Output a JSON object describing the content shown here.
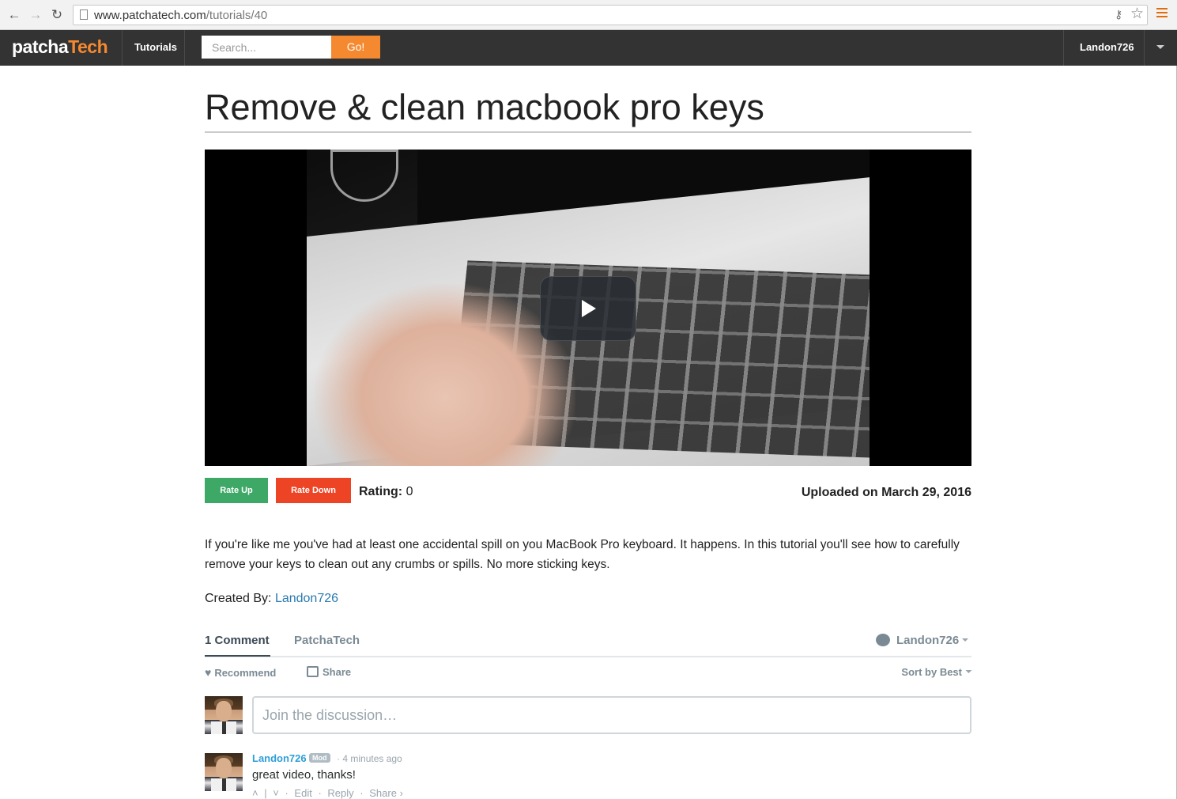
{
  "browser": {
    "url_domain": "www.patchatech.com",
    "url_path": "/tutorials/40",
    "icons": [
      "back-icon",
      "forward-icon",
      "reload-icon",
      "page-icon",
      "key-icon",
      "star-icon",
      "menu-icon"
    ]
  },
  "nav": {
    "logo_part1": "patcha",
    "logo_part2": "Tech",
    "tutorials_label": "Tutorials",
    "search_placeholder": "Search...",
    "go_label": "Go!",
    "user_label": "Landon726"
  },
  "tutorial": {
    "title": "Remove & clean macbook pro keys",
    "rate_up_label": "Rate Up",
    "rate_down_label": "Rate Down",
    "rating_label": "Rating:",
    "rating_value": "0",
    "uploaded": "Uploaded on March 29, 2016",
    "description": "If you're like me you've had at least one accidental spill on you MacBook Pro keyboard. It happens. In this tutorial you'll see how to carefully remove your keys to clean out any crumbs or spills. No more sticking keys.",
    "created_by_label": "Created By:",
    "created_by_user": "Landon726"
  },
  "comments": {
    "tab_comments": "1 Comment",
    "tab_site": "PatchaTech",
    "user_menu": "Landon726",
    "recommend_label": "Recommend",
    "share_label": "Share",
    "sort_label": "Sort by Best",
    "input_placeholder": "Join the discussion…",
    "items": [
      {
        "author": "Landon726",
        "badge": "Mod",
        "time": "4 minutes ago",
        "text": "great video, thanks!",
        "action_edit": "Edit",
        "action_reply": "Reply",
        "action_share": "Share ›"
      }
    ]
  },
  "colors": {
    "brand_orange": "#f5892f",
    "nav_bg": "#333333",
    "rate_up": "#3ea867",
    "rate_down": "#ee4426",
    "link_blue": "#2a7ab0",
    "disqus_blue": "#2e9fd8"
  }
}
